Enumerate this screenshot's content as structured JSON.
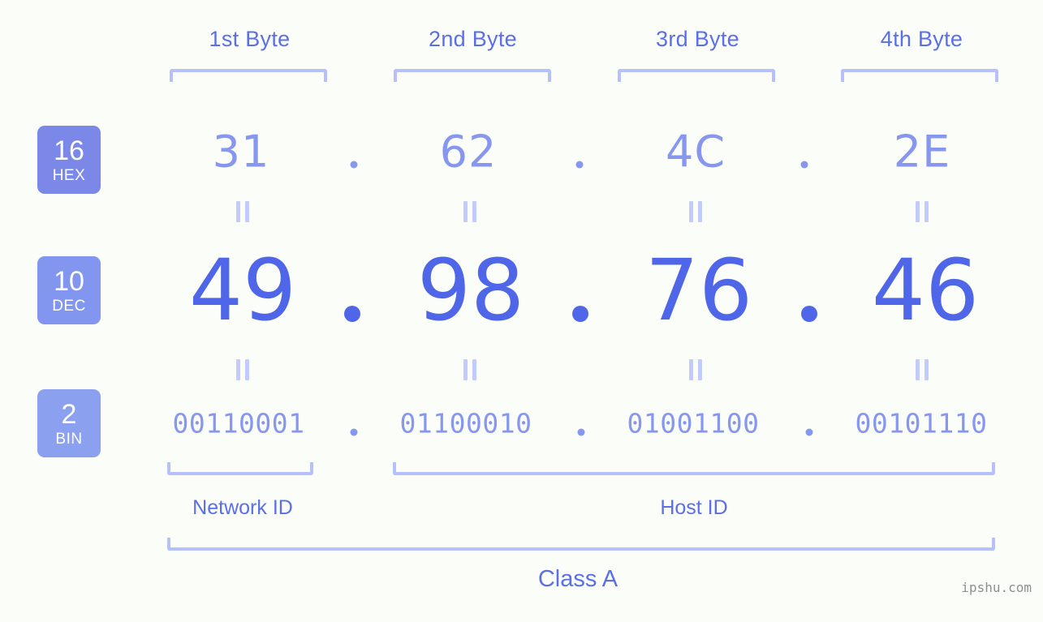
{
  "meta": {
    "background_color": "#fbfdf8",
    "accent_color": "#5a6fe8",
    "light_accent_color": "#8796ef",
    "bracket_color": "#b6c1fb"
  },
  "byte_headers": [
    {
      "label": "1st Byte"
    },
    {
      "label": "2nd Byte"
    },
    {
      "label": "3rd Byte"
    },
    {
      "label": "4th Byte"
    }
  ],
  "bases": [
    {
      "number": "16",
      "name": "HEX",
      "color": "#7b88e8"
    },
    {
      "number": "10",
      "name": "DEC",
      "color": "#8295ef"
    },
    {
      "number": "2",
      "name": "BIN",
      "color": "#8ca0f0"
    }
  ],
  "rows": {
    "hex": {
      "values": [
        "31",
        "62",
        "4C",
        "2E"
      ],
      "separator": "."
    },
    "dec": {
      "values": [
        "49",
        "98",
        "76",
        "46"
      ],
      "separator": "."
    },
    "bin": {
      "values": [
        "00110001",
        "01100010",
        "01001100",
        "00101110"
      ],
      "separator": "."
    }
  },
  "equality_symbol": "=",
  "sections": [
    {
      "label": "Network ID"
    },
    {
      "label": "Host ID"
    }
  ],
  "class": {
    "label": "Class A"
  },
  "watermark": {
    "text": "ipshu.com"
  }
}
